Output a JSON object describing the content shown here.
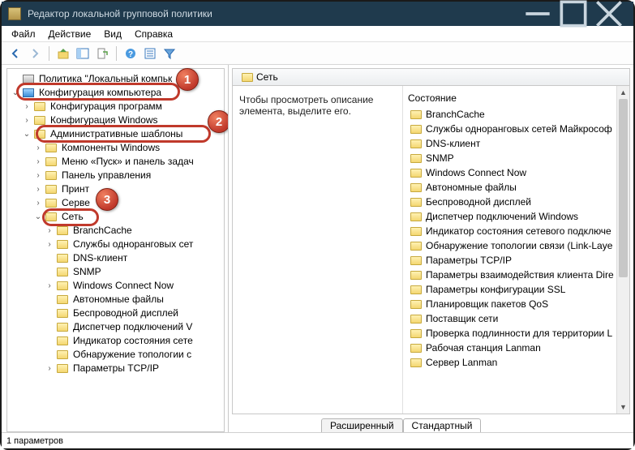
{
  "window": {
    "title": "Редактор локальной групповой политики"
  },
  "menu": {
    "file": "Файл",
    "action": "Действие",
    "view": "Вид",
    "help": "Справка"
  },
  "tree": {
    "root": "Политика \"Локальный компьк",
    "computer_config": "Конфигурация компьютера",
    "items": [
      {
        "label": "Конфигурация программ",
        "exp": ">"
      },
      {
        "label": "Конфигурация Windows",
        "exp": ">"
      },
      {
        "label": "Административные шаблоны",
        "exp": "v"
      }
    ],
    "admin_children": [
      {
        "label": "Компоненты Windows",
        "exp": ">"
      },
      {
        "label": "Меню «Пуск» и панель задач",
        "exp": ">"
      },
      {
        "label": "Панель управления",
        "exp": ">"
      },
      {
        "label": "Принт",
        "exp": ">"
      },
      {
        "label": "Серве",
        "exp": ">"
      },
      {
        "label": "Сеть",
        "exp": "v"
      }
    ],
    "network_children": [
      {
        "label": "BranchCache",
        "exp": ">"
      },
      {
        "label": "Службы одноранговых сет",
        "exp": ">"
      },
      {
        "label": "DNS-клиент",
        "exp": ""
      },
      {
        "label": "SNMP",
        "exp": ""
      },
      {
        "label": "Windows Connect Now",
        "exp": ">"
      },
      {
        "label": "Автономные файлы",
        "exp": ""
      },
      {
        "label": "Беспроводной дисплей",
        "exp": ""
      },
      {
        "label": "Диспетчер подключений V",
        "exp": ""
      },
      {
        "label": "Индикатор состояния сете",
        "exp": ""
      },
      {
        "label": "Обнаружение топологии с",
        "exp": ""
      },
      {
        "label": "Параметры TCP/IP",
        "exp": ">"
      }
    ]
  },
  "panel": {
    "header": "Сеть",
    "description": "Чтобы просмотреть описание элемента, выделите его.",
    "column": "Состояние",
    "folders": [
      "BranchCache",
      "Службы одноранговых сетей Майкрософ",
      "DNS-клиент",
      "SNMP",
      "Windows Connect Now",
      "Автономные файлы",
      "Беспроводной дисплей",
      "Диспетчер подключений Windows",
      "Индикатор состояния сетевого подключе",
      "Обнаружение топологии связи (Link-Laye",
      "Параметры TCP/IP",
      "Параметры взаимодействия клиента Dire",
      "Параметры конфигурации SSL",
      "Планировщик пакетов QoS",
      "Поставщик сети",
      "Проверка подлинности для территории L",
      "Рабочая станция Lanman",
      "Сервер Lanman"
    ]
  },
  "tabs": {
    "extended": "Расширенный",
    "standard": "Стандартный"
  },
  "status": "1 параметров"
}
